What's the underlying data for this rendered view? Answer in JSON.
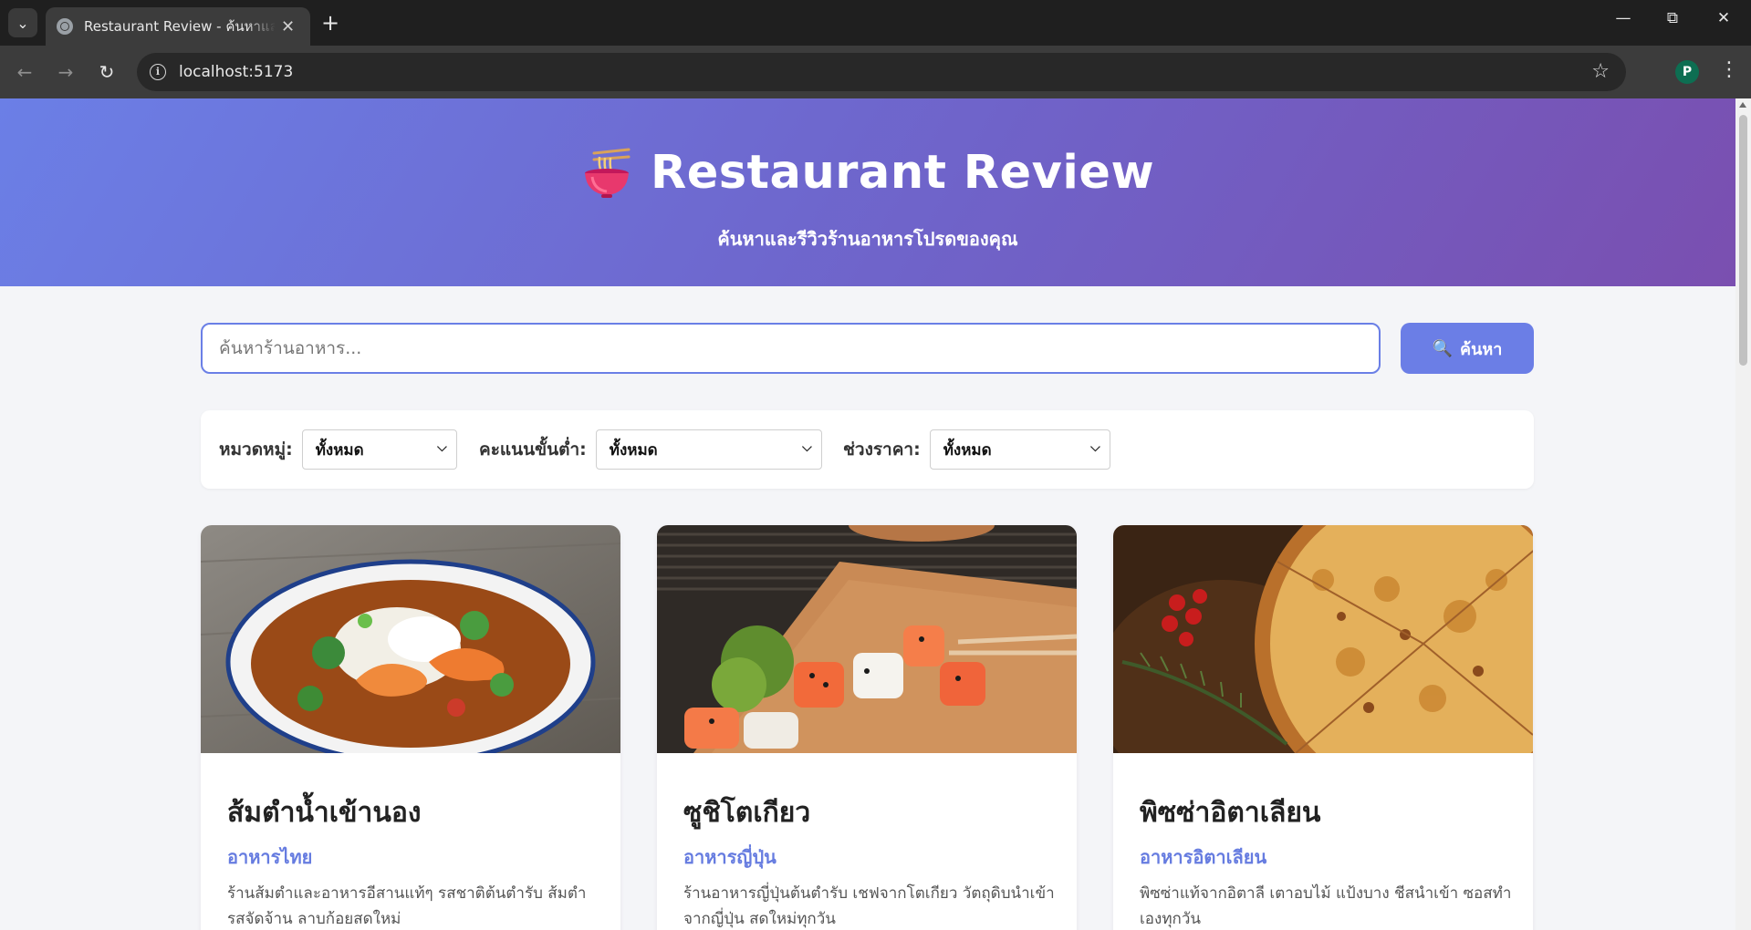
{
  "browser": {
    "tab_title": "Restaurant Review - ค้นหาและรีวิวร้านอาหาร",
    "url": "localhost:5173",
    "profile_initial": "P"
  },
  "hero": {
    "title": "Restaurant Review",
    "subtitle": "ค้นหาและรีวิวร้านอาหารโปรดของคุณ",
    "icon": "noodle-bowl-icon"
  },
  "search": {
    "placeholder": "ค้นหาร้านอาหาร...",
    "button_label": "ค้นหา",
    "button_icon": "search-icon"
  },
  "filters": [
    {
      "label": "หมวดหมู่:",
      "value": "ทั้งหมด"
    },
    {
      "label": "คะแนนขั้นต่ำ:",
      "value": "ทั้งหมด"
    },
    {
      "label": "ช่วงราคา:",
      "value": "ทั้งหมด"
    }
  ],
  "restaurants": [
    {
      "name": "ส้มตำน้ำเข้านอง",
      "category": "อาหารไทย",
      "description": "ร้านส้มตำและอาหารอีสานแท้ๆ รสชาติต้นตำรับ ส้มตำรสจัดจ้าน ลาบก้อยสดใหม่"
    },
    {
      "name": "ซูชิโตเกียว",
      "category": "อาหารญี่ปุ่น",
      "description": "ร้านอาหารญี่ปุ่นต้นตำรับ เชฟจากโตเกียว วัตถุดิบนำเข้าจากญี่ปุ่น สดใหม่ทุกวัน"
    },
    {
      "name": "พิซซ่าอิตาเลียน",
      "category": "อาหารอิตาเลียน",
      "description": "พิซซ่าแท้จากอิตาลี เตาอบไม้ แป้งบาง ชีสนำเข้า ซอสทำเองทุกวัน"
    }
  ],
  "colors": {
    "accent": "#6b7ee6",
    "hero_gradient_start": "#6b7fe6",
    "hero_gradient_end": "#7a4fb0",
    "category_text": "#667ce0"
  }
}
